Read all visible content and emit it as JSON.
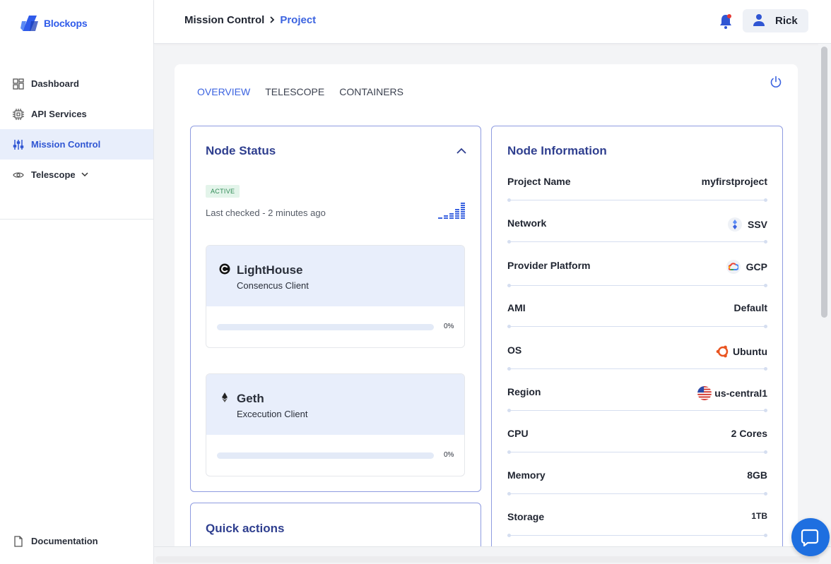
{
  "app": {
    "brand": "Blockops",
    "accent": "#3b63e0"
  },
  "sidebar": {
    "items": [
      {
        "label": "Dashboard",
        "icon": "dashboard-icon",
        "active": false
      },
      {
        "label": "API Services",
        "icon": "chip-icon",
        "active": false
      },
      {
        "label": "Mission Control",
        "icon": "sliders-icon",
        "active": true
      },
      {
        "label": "Telescope",
        "icon": "eye-icon",
        "active": false,
        "expandable": true
      }
    ],
    "bottom": {
      "label": "Documentation",
      "icon": "document-icon"
    }
  },
  "header": {
    "breadcrumb_root": "Mission Control",
    "breadcrumb_sep": ">",
    "breadcrumb_current": "Project",
    "user_name": "Rick"
  },
  "tabs": [
    "OVERVIEW",
    "TELESCOPE",
    "CONTAINERS"
  ],
  "node_status": {
    "title": "Node Status",
    "badge": "ACTIVE",
    "last_checked": "Last checked - 2 minutes ago",
    "clients": [
      {
        "name": "LightHouse",
        "type": "Consencus Client",
        "progress_label": "0%",
        "progress": 0
      },
      {
        "name": "Geth",
        "type": "Excecution Client",
        "progress_label": "0%",
        "progress": 0
      }
    ]
  },
  "quick_actions": {
    "title": "Quick actions"
  },
  "node_info": {
    "title": "Node Information",
    "rows": [
      {
        "label": "Project Name",
        "value": "myfirstproject",
        "icon": ""
      },
      {
        "label": "Network",
        "value": "SSV",
        "icon": "ssv-icon"
      },
      {
        "label": "Provider Platform",
        "value": "GCP",
        "icon": "gcp-icon"
      },
      {
        "label": "AMI",
        "value": "Default",
        "icon": ""
      },
      {
        "label": "OS",
        "value": "Ubuntu",
        "icon": "ubuntu-icon"
      },
      {
        "label": "Region",
        "value": "us-central1",
        "icon": "us-flag-icon"
      },
      {
        "label": "CPU",
        "value": "2 Cores",
        "icon": ""
      },
      {
        "label": "Memory",
        "value": "8GB",
        "icon": ""
      },
      {
        "label": "Storage",
        "value": "1TB",
        "icon": ""
      }
    ]
  }
}
